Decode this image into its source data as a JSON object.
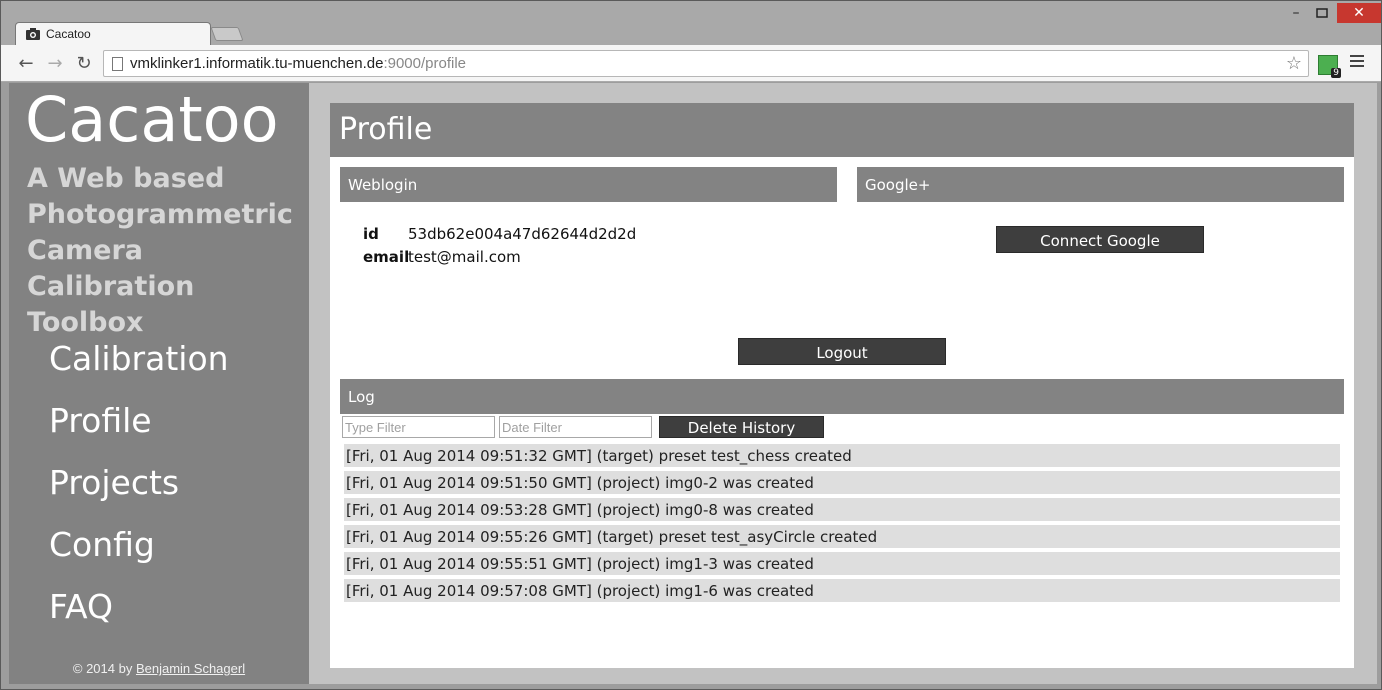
{
  "browser": {
    "tab_title": "Cacatoo",
    "url_host": "vmklinker1.informatik.tu-muenchen.de",
    "url_path": ":9000/profile",
    "extension_badge": "9"
  },
  "sidebar": {
    "brand": "Cacatoo",
    "tagline": "A Web based Photogrammetric Camera Calibration Toolbox",
    "nav": [
      {
        "label": "Calibration"
      },
      {
        "label": "Profile"
      },
      {
        "label": "Projects"
      },
      {
        "label": "Config"
      },
      {
        "label": "FAQ"
      }
    ],
    "footer_prefix": "© 2014 by ",
    "footer_author": "Benjamin Schagerl"
  },
  "main": {
    "title": "Profile",
    "weblogin": {
      "heading": "Weblogin",
      "id_label": "id",
      "id_value": "53db62e004a47d62644d2d2d",
      "email_label": "email",
      "email_value": "test@mail.com"
    },
    "google": {
      "heading": "Google+",
      "connect_label": "Connect Google"
    },
    "logout_label": "Logout",
    "log": {
      "heading": "Log",
      "type_filter_placeholder": "Type Filter",
      "date_filter_placeholder": "Date Filter",
      "delete_label": "Delete History",
      "entries": [
        "[Fri, 01 Aug 2014 09:51:32 GMT] (target) preset test_chess created",
        "[Fri, 01 Aug 2014 09:51:50 GMT] (project) img0-2 was created",
        "[Fri, 01 Aug 2014 09:53:28 GMT] (project) img0-8 was created",
        "[Fri, 01 Aug 2014 09:55:26 GMT] (target) preset test_asyCircle created",
        "[Fri, 01 Aug 2014 09:55:51 GMT] (project) img1-3 was created",
        "[Fri, 01 Aug 2014 09:57:08 GMT] (project) img1-6 was created"
      ]
    }
  }
}
